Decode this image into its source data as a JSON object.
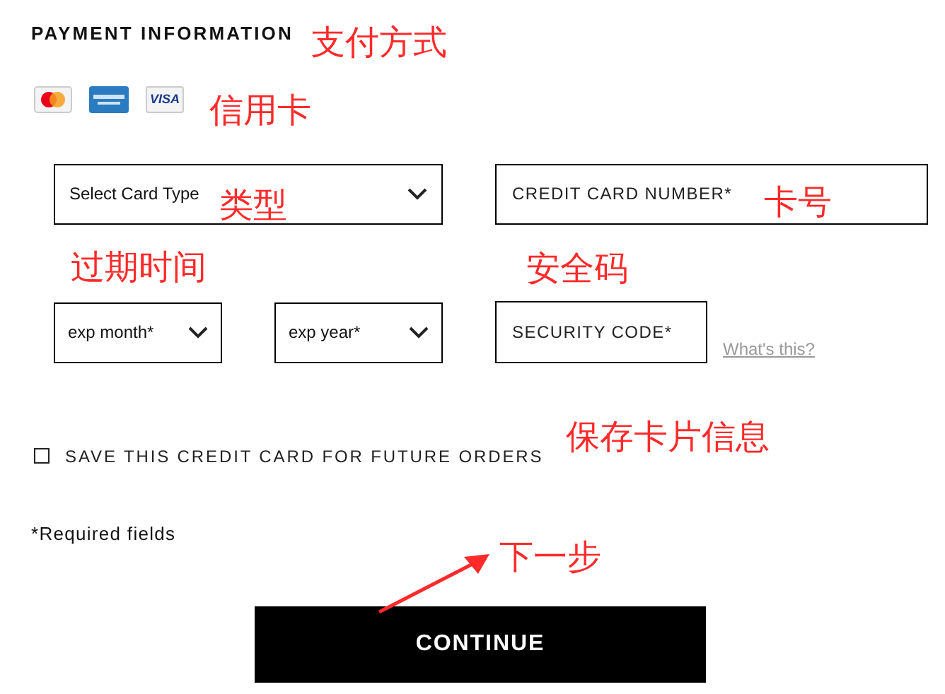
{
  "title": "PAYMENT INFORMATION",
  "cards": [
    {
      "kind": "mastercard"
    },
    {
      "kind": "amex"
    },
    {
      "kind": "visa",
      "label": "VISA"
    }
  ],
  "card_type": {
    "value": "Select Card Type"
  },
  "card_number": {
    "placeholder": "CREDIT CARD NUMBER*"
  },
  "exp_month": {
    "value": "exp month*"
  },
  "exp_year": {
    "value": "exp year*"
  },
  "security_code": {
    "placeholder": "SECURITY CODE*"
  },
  "help_link": "What's this?",
  "save_card": {
    "label": "SAVE THIS CREDIT CARD FOR FUTURE ORDERS",
    "checked": false
  },
  "required_note": "*Required fields",
  "continue_button": "CONTINUE",
  "annotations": [
    {
      "text": "支付方式",
      "kind": "title"
    },
    {
      "text": "信用卡",
      "kind": "cards"
    },
    {
      "text": "类型",
      "kind": "type"
    },
    {
      "text": "卡号",
      "kind": "number"
    },
    {
      "text": "过期时间",
      "kind": "expiry"
    },
    {
      "text": "安全码",
      "kind": "code"
    },
    {
      "text": "保存卡片信息",
      "kind": "save"
    },
    {
      "text": "下一步",
      "kind": "next"
    }
  ]
}
